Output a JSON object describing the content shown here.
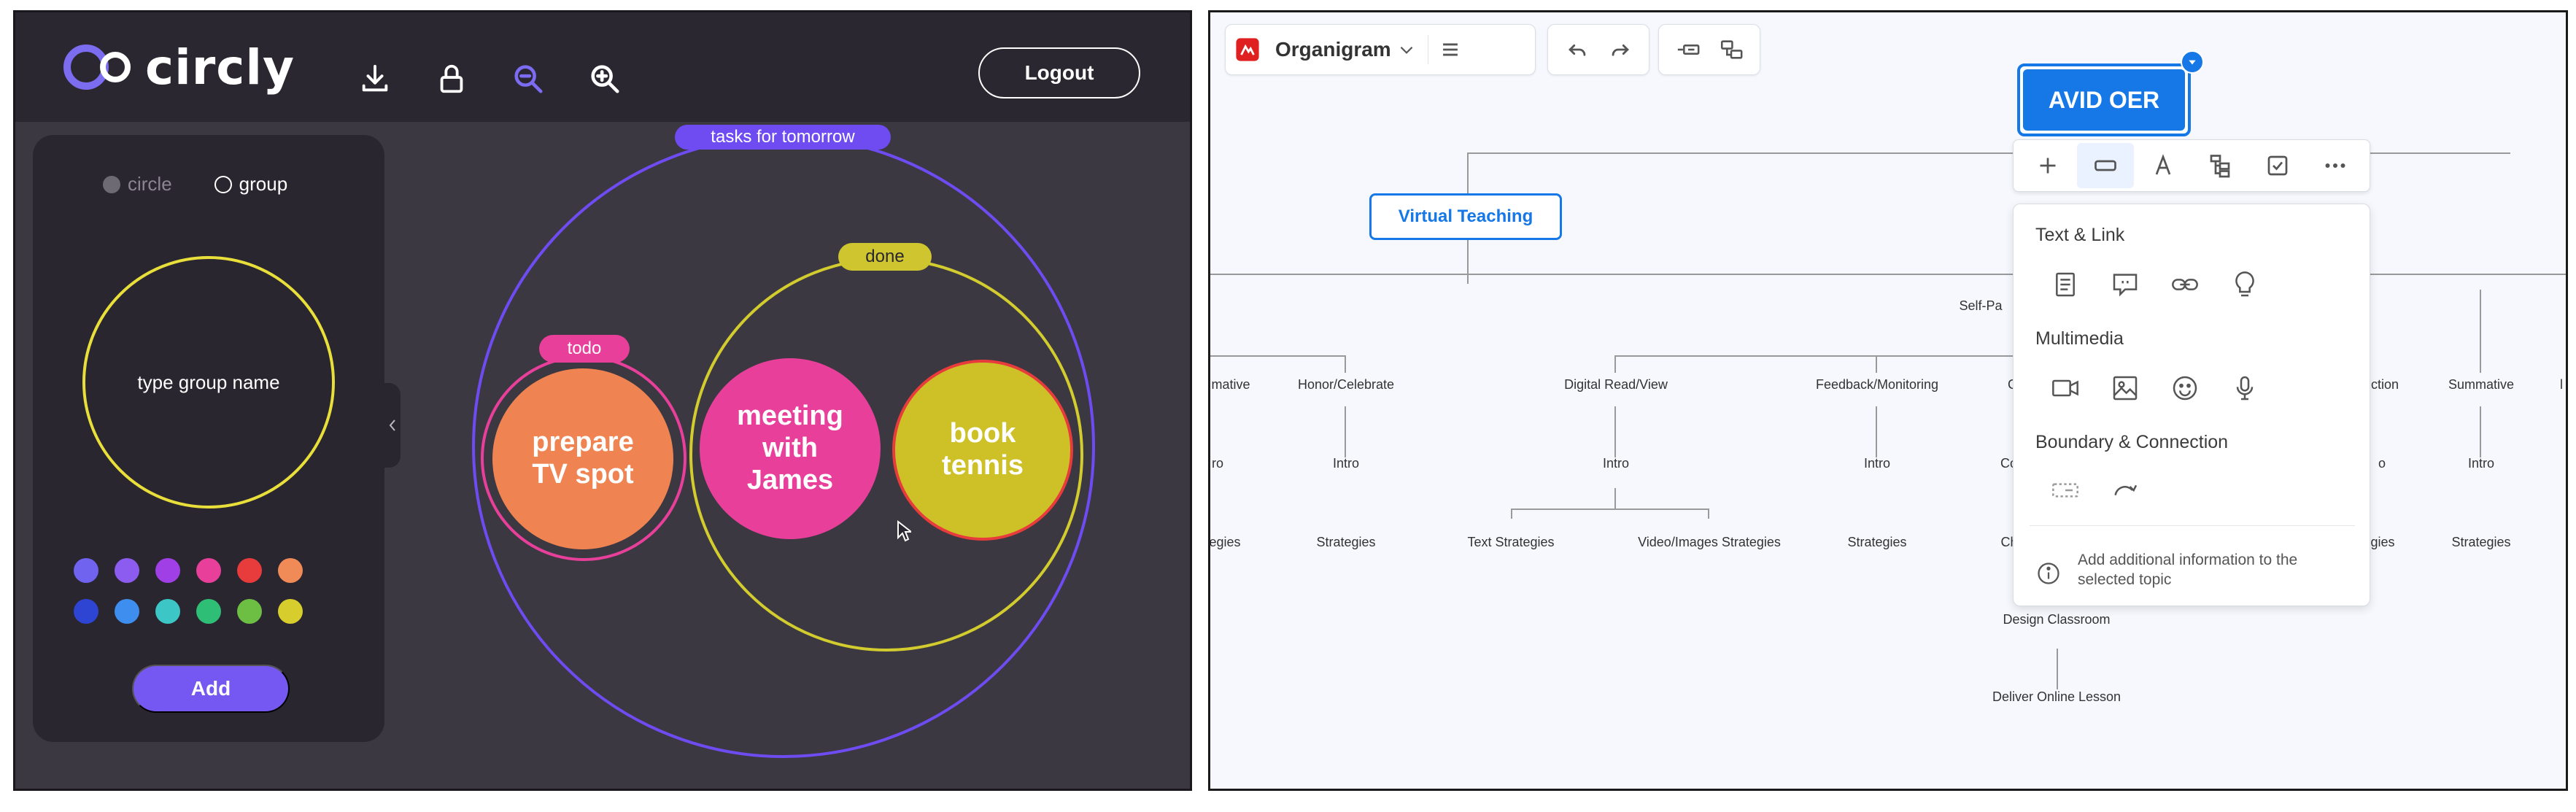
{
  "circly": {
    "app_name": "circly",
    "logout_label": "Logout",
    "toolbar_icons": [
      "download-icon",
      "lock-icon",
      "search-zoom-out-icon",
      "search-zoom-in-icon"
    ],
    "sidebar": {
      "mode_circle": "circle",
      "mode_group": "group",
      "selected_mode": "group",
      "group_name_placeholder": "type group name",
      "colors": [
        "#6f63ef",
        "#8c5cf0",
        "#a03fe6",
        "#e8409a",
        "#e83c3c",
        "#f08a57",
        "#2d45d2",
        "#3e8ef0",
        "#3cc6c6",
        "#2fbe76",
        "#6dbf43",
        "#d7cd2c"
      ],
      "add_label": "Add"
    },
    "canvas": {
      "groups": [
        {
          "label": "tasks for tomorrow",
          "color": "#6e4cf2"
        },
        {
          "label": "done",
          "color": "#d2cc2e"
        },
        {
          "label": "todo",
          "color": "#e8409a"
        }
      ],
      "circles": [
        {
          "text": "prepare\nTV spot",
          "color": "#ef8452"
        },
        {
          "text": "meeting\nwith\nJames",
          "color": "#e8409a"
        },
        {
          "text": "book\ntennis",
          "color": "#cec128"
        }
      ]
    }
  },
  "org": {
    "map_name": "Organigram",
    "root_node": "AVID OER",
    "selected_node": "Virtual Teaching",
    "nodes": {
      "self_paced": "Self-Pa",
      "summative_left": "mative",
      "honor": "Honor/Celebrate",
      "digital": "Digital Read/View",
      "feedback": "Feedback/Monitoring",
      "g_partial": "G",
      "ction": "ction",
      "summative_right": "Summative",
      "l_partial": "l",
      "intro_left_partial": "ro",
      "intro_honor": "Intro",
      "intro_digital": "Intro",
      "intro_feedback": "Intro",
      "com_partial": "Com",
      "intro_o_partial": "o",
      "intro_summative": "Intro",
      "strategies_left_partial": "egies",
      "strategies_honor": "Strategies",
      "text_strategies": "Text Strategies",
      "video_strategies": "Video/Images Strategies",
      "strategies_feedback": "Strategies",
      "cho_partial": "Cho",
      "strategies_right_partial": "egies",
      "strategies_summative": "Strategies",
      "design_classroom": "Design Classroom",
      "deliver_online": "Deliver Online Lesson"
    },
    "insert_menu": {
      "section_text_link": "Text & Link",
      "text_link_icons": [
        "note-icon",
        "comment-icon",
        "link-icon",
        "lightbulb-icon"
      ],
      "section_multimedia": "Multimedia",
      "multimedia_icons": [
        "video-icon",
        "image-icon",
        "emoji-icon",
        "microphone-icon"
      ],
      "section_boundary": "Boundary & Connection",
      "boundary_icons": [
        "boundary-icon",
        "connection-icon"
      ],
      "info_text": "Add additional information to the selected topic"
    },
    "accent_color": "#1677e6"
  }
}
